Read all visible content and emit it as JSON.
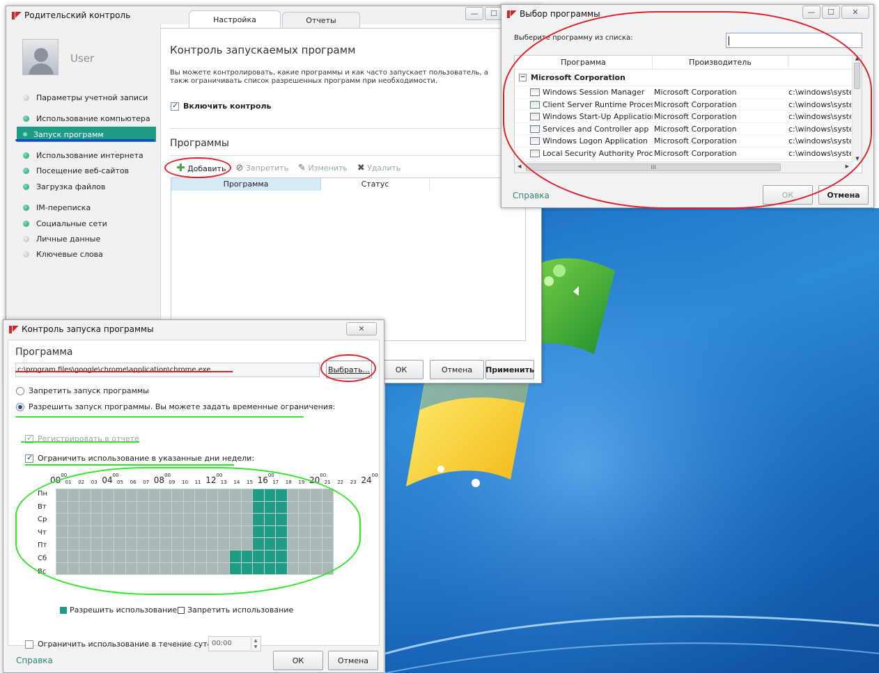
{
  "main_window": {
    "title": "Родительский контроль",
    "tabs": [
      "Настройка",
      "Отчеты"
    ],
    "user_name": "User",
    "sidebar": [
      {
        "label": "Параметры учетной записи",
        "status": "off"
      },
      {
        "label": "Использование компьютера",
        "status": "on"
      },
      {
        "label": "Запуск программ",
        "status": "on",
        "selected": true
      },
      {
        "label": "Использование интернета",
        "status": "on"
      },
      {
        "label": "Посещение веб-сайтов",
        "status": "on"
      },
      {
        "label": "Загрузка файлов",
        "status": "on"
      },
      {
        "label": "IM-переписка",
        "status": "on"
      },
      {
        "label": "Социальные сети",
        "status": "on"
      },
      {
        "label": "Личные данные",
        "status": "off"
      },
      {
        "label": "Ключевые слова",
        "status": "off"
      }
    ],
    "section_title": "Контроль запускаемых программ",
    "description": "Вы можете контролировать, какие программы и как часто запускает пользователь, а такж ограничивать список разрешенных программ при необходимости.",
    "enable_label": "Включить контроль",
    "programs_title": "Программы",
    "toolbar": {
      "add": "Добавить",
      "block": "Запретить",
      "edit": "Изменить",
      "delete": "Удалить"
    },
    "columns": [
      "Программа",
      "Статус"
    ],
    "buttons": {
      "ok": "ОК",
      "cancel": "Отмена",
      "apply": "Применить"
    }
  },
  "select_dialog": {
    "title": "Выбор программы",
    "prompt": "Выберите программу из списка:",
    "search_value": "",
    "columns": [
      "Программа",
      "Производитель"
    ],
    "group": "Microsoft Corporation",
    "rows": [
      {
        "name": "Windows Session Manager",
        "vendor": "Microsoft Corporation",
        "path": "c:\\windows\\syste"
      },
      {
        "name": "Client Server Runtime Process",
        "vendor": "Microsoft Corporation",
        "path": "c:\\windows\\syste"
      },
      {
        "name": "Windows Start-Up Application",
        "vendor": "Microsoft Corporation",
        "path": "c:\\windows\\syste"
      },
      {
        "name": "Services and Controller app",
        "vendor": "Microsoft Corporation",
        "path": "c:\\windows\\syste"
      },
      {
        "name": "Windows Logon Application",
        "vendor": "Microsoft Corporation",
        "path": "c:\\windows\\syste"
      },
      {
        "name": "Local Security Authority Proc...",
        "vendor": "Microsoft Corporation",
        "path": "c:\\windows\\syste"
      }
    ],
    "scroll_indicator": "III",
    "help": "Справка",
    "ok": "ОК",
    "cancel": "Отмена"
  },
  "launch_dialog": {
    "title": "Контроль запуска программы",
    "program_label": "Программа",
    "program_path": "c:\\program files\\google\\chrome\\application\\chrome.exe",
    "choose_button": "Выбрать...",
    "deny_radio": "Запретить запуск программы",
    "allow_radio": "Разрешить запуск программы. Вы можете задать временные ограничения:",
    "log_checkbox": "Регистрировать в отчете",
    "limit_days_checkbox": "Ограничить использование в указанные дни недели:",
    "hours_big": [
      "00",
      "04",
      "08",
      "12",
      "16",
      "20",
      "24"
    ],
    "hours_sup": "00",
    "hours_small": [
      "01",
      "02",
      "03",
      "05",
      "06",
      "07",
      "09",
      "10",
      "11",
      "13",
      "14",
      "15",
      "17",
      "18",
      "19",
      "21",
      "22",
      "23"
    ],
    "days": [
      "Пн",
      "Вт",
      "Ср",
      "Чт",
      "Пт",
      "Сб",
      "Вс"
    ],
    "allowed_hours": [
      [
        17,
        18,
        19
      ],
      [
        17,
        18,
        19
      ],
      [
        17,
        18,
        19
      ],
      [
        17,
        18,
        19
      ],
      [
        17,
        18,
        19
      ],
      [
        15,
        16,
        17,
        18,
        19
      ],
      [
        15,
        16,
        17,
        18,
        19
      ]
    ],
    "legend_allow": "Разрешить использование",
    "legend_deny": "Запретить использование",
    "limit_daily_checkbox": "Ограничить использование в течение суток:",
    "daily_value": "00:00",
    "help": "Справка",
    "ok": "ОК",
    "cancel": "Отмена"
  },
  "colors": {
    "accent": "#1f9c86",
    "annotation_red": "#e21f26",
    "annotation_green": "#2ee52a",
    "annotation_blue": "#1f3fd0"
  }
}
